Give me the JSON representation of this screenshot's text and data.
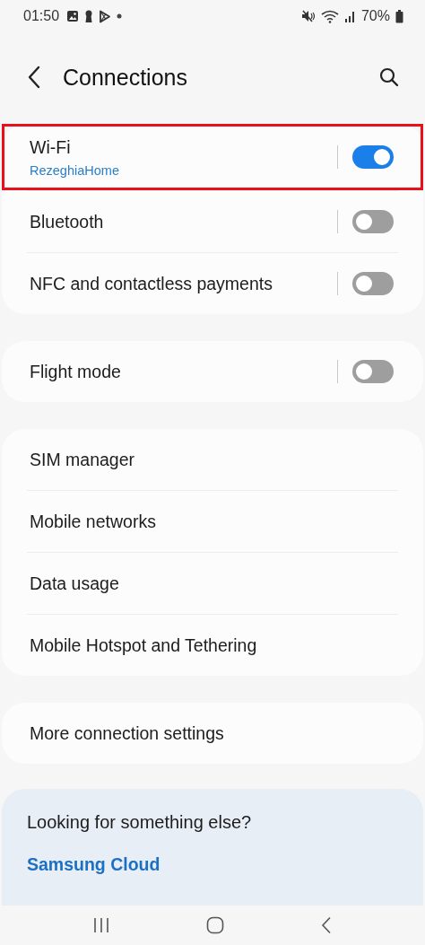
{
  "status_bar": {
    "time": "01:50",
    "battery": "70%"
  },
  "header": {
    "title": "Connections"
  },
  "groups": [
    {
      "items": [
        {
          "kind": "toggle",
          "label": "Wi-Fi",
          "subtitle": "RezeghiaHome",
          "on": true,
          "highlighted": true
        },
        {
          "kind": "toggle",
          "label": "Bluetooth",
          "on": false,
          "highlighted": false
        },
        {
          "kind": "toggle",
          "label": "NFC and contactless payments",
          "on": false,
          "highlighted": false
        }
      ]
    },
    {
      "items": [
        {
          "kind": "toggle",
          "label": "Flight mode",
          "on": false,
          "highlighted": false
        }
      ]
    },
    {
      "items": [
        {
          "kind": "link",
          "label": "SIM manager",
          "highlighted": false
        },
        {
          "kind": "link",
          "label": "Mobile networks",
          "highlighted": false
        },
        {
          "kind": "link",
          "label": "Data usage",
          "highlighted": false
        },
        {
          "kind": "link",
          "label": "Mobile Hotspot and Tethering",
          "highlighted": false
        }
      ]
    },
    {
      "items": [
        {
          "kind": "link",
          "label": "More connection settings",
          "highlighted": false
        }
      ]
    }
  ],
  "suggestions": {
    "title": "Looking for something else?",
    "links": [
      "Samsung Cloud"
    ]
  }
}
